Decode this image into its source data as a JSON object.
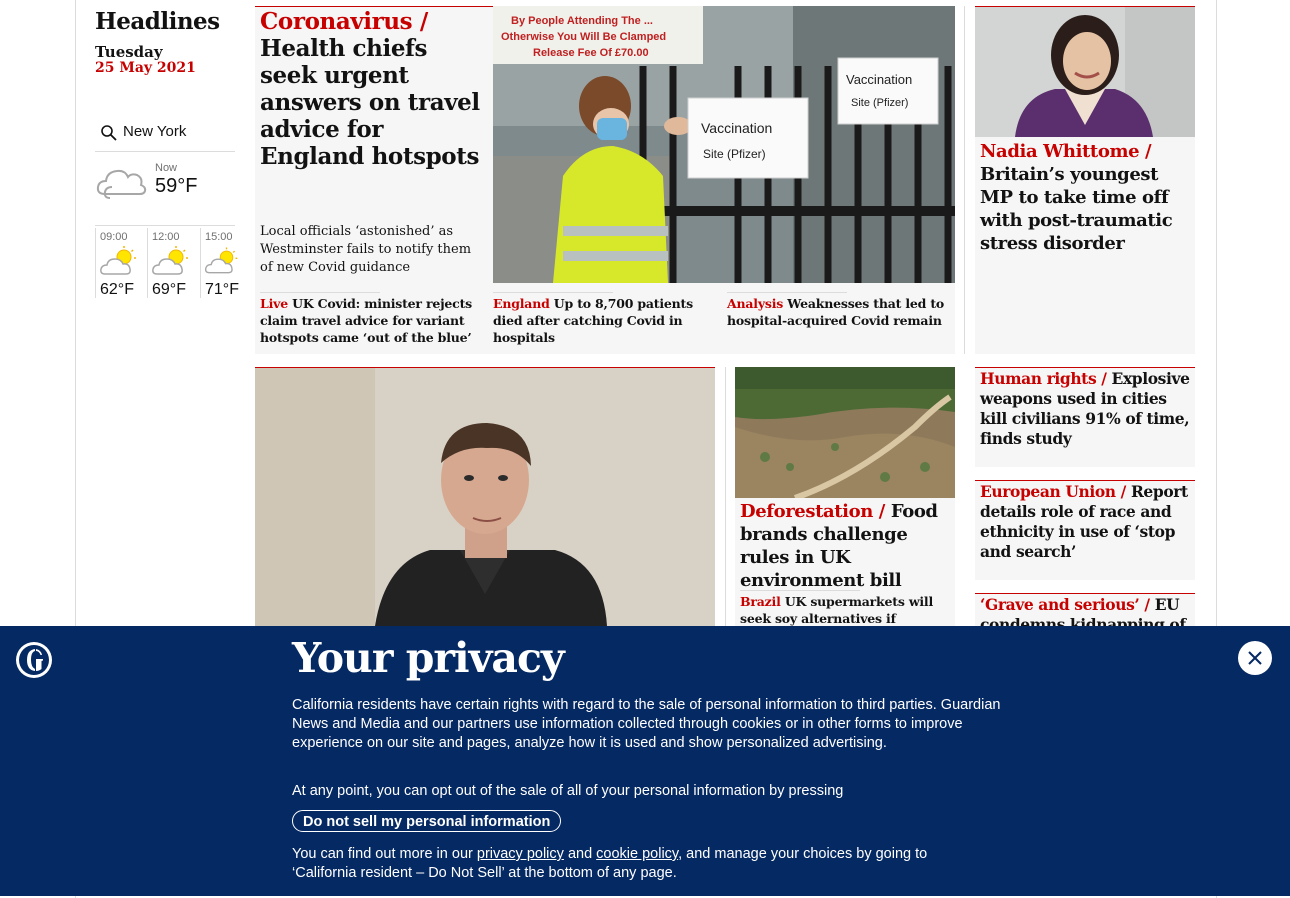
{
  "sidebar": {
    "title": "Headlines",
    "day": "Tuesday",
    "date": "25 May 2021",
    "weather": {
      "location": "New York",
      "now_label": "Now",
      "now_temp": "59°F",
      "forecast": [
        {
          "time": "09:00",
          "temp": "62°F"
        },
        {
          "time": "12:00",
          "temp": "69°F"
        },
        {
          "time": "15:00",
          "temp": "71°F"
        }
      ]
    }
  },
  "lead": {
    "kicker": "Coronavirus /",
    "headline": "Health chiefs seek urgent answers on travel advice for England hotspots",
    "standfirst": "Local officials ‘astonished’ as Westminster fails to notify them of new Covid guidance",
    "sub": {
      "kicker": "Live",
      "text": "UK Covid: minister rejects claim travel advice for variant hotspots came ‘out of the blue’"
    },
    "photo_signs": {
      "top": "By People Attending The ... Otherwise You Will Be Clamped Release Fee Of £70.00",
      "sign1_a": "Vaccination",
      "sign1_b": "Site (Pfizer)",
      "sign2_a": "Vaccination",
      "sign2_b": "Site (Pfizer)"
    },
    "related": [
      {
        "kicker": "England",
        "text": "Up to 8,700 patients died after catching Covid in hospitals"
      },
      {
        "kicker": "Analysis",
        "text": "Weaknesses that led to hospital-acquired Covid remain"
      }
    ]
  },
  "right_top": {
    "kicker": "Nadia Whittome /",
    "headline": "Britain’s youngest MP to take time off with post-traumatic stress disorder"
  },
  "deforestation": {
    "kicker": "Deforestation /",
    "headline": "Food brands challenge rules in UK environment bill",
    "sub": {
      "kicker": "Brazil",
      "text": "UK supermarkets will seek soy alternatives if Amazon"
    }
  },
  "right_list": [
    {
      "kicker": "Human rights /",
      "text": "Explosive weapons used in cities kill civilians 91% of time, finds study"
    },
    {
      "kicker": "European Union /",
      "text": "Report details role of race and ethnicity in use of ‘stop and search’"
    },
    {
      "kicker": "‘Grave and serious’ /",
      "text": "EU condemns kidnapping of"
    }
  ],
  "privacy": {
    "title": "Your privacy",
    "para1": "California residents have certain rights with regard to the sale of personal information to third parties. Guardian News and Media and our partners use information collected through cookies or in other forms to improve experience on our site and pages, analyze how it is used and show personalized advertising.",
    "para2": "At any point, you can opt out of the sale of all of your personal information by pressing",
    "button": "Do not sell my personal information",
    "para3_a": "You can find out more in our",
    "privacy_link": "privacy policy",
    "para3_b": "and",
    "cookie_link": "cookie policy",
    "para3_c": ", and manage your choices by going to ‘California resident – Do Not Sell’ at the bottom of any page."
  },
  "colors": {
    "accent": "#c70000",
    "banner": "#052962",
    "card_bg": "#f6f6f6"
  }
}
